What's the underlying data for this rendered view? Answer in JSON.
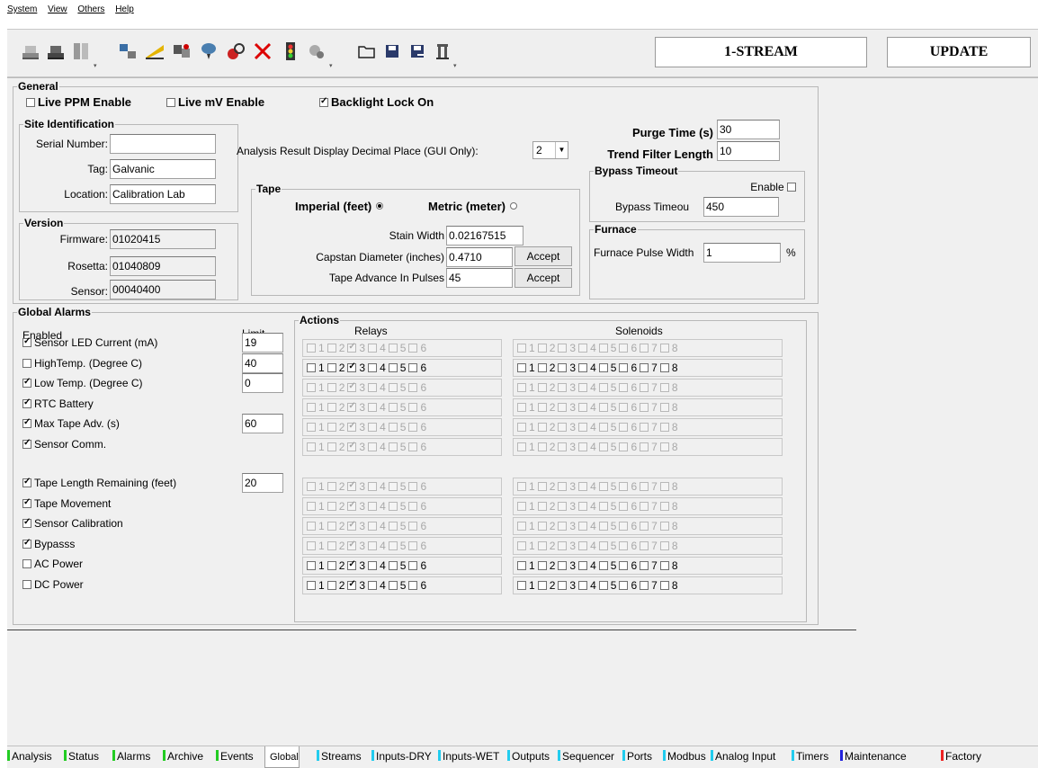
{
  "menu": [
    "System",
    "View",
    "Others",
    "Help"
  ],
  "toolbar": {
    "icons": [
      "dry-tank-icon",
      "wet-tank-icon",
      "stack-icon",
      "device-link-icon",
      "scan-icon",
      "transfer-icon",
      "balloon-icon",
      "bomb-reset-icon",
      "cancel-icon",
      "traffic-light-icon",
      "gears-icon",
      "open-folder-icon",
      "save-icon",
      "save-as-icon",
      "user-icon"
    ],
    "stream_label": "1-STREAM",
    "update_label": "UPDATE"
  },
  "general": {
    "title": "General",
    "live_ppm": {
      "label": "Live PPM Enable",
      "checked": false
    },
    "live_mv": {
      "label": "Live mV Enable",
      "checked": false
    },
    "backlight": {
      "label": "Backlight Lock On",
      "checked": true
    },
    "decimal_label": "Analysis Result Display Decimal Place (GUI Only):",
    "decimal_value": "2",
    "purge_label": "Purge Time (s)",
    "purge_value": "30",
    "trend_label": "Trend Filter Length",
    "trend_value": "10"
  },
  "site": {
    "title": "Site Identification",
    "serial_label": "Serial Number:",
    "serial_value": "",
    "tag_label": "Tag:",
    "tag_value": "Galvanic",
    "location_label": "Location:",
    "location_value": "Calibration Lab"
  },
  "version": {
    "title": "Version",
    "firmware_label": "Firmware:",
    "firmware_value": "01020415",
    "rosetta_label": "Rosetta:",
    "rosetta_value": "01040809",
    "sensor_label": "Sensor:",
    "sensor_value": "00040400"
  },
  "tape": {
    "title": "Tape",
    "imperial_label": "Imperial (feet)",
    "metric_label": "Metric (meter)",
    "stain_label": "Stain Width",
    "stain_value": "0.02167515",
    "capstan_label": "Capstan Diameter (inches)",
    "capstan_value": "0.4710",
    "advance_label": "Tape Advance In Pulses",
    "advance_value": "45",
    "accept_label": "Accept"
  },
  "bypass": {
    "title": "Bypass Timeout",
    "enable_label": "Enable",
    "timeout_label": "Bypass Timeou",
    "timeout_value": "450"
  },
  "furnace": {
    "title": "Furnace",
    "pulse_label": "Furnace Pulse Width",
    "pulse_value": "1",
    "unit": "%"
  },
  "alarms": {
    "title": "Global Alarms",
    "enabled_header": "Enabled",
    "limit_header": "Limit",
    "rows": [
      {
        "label": "Sensor LED Current (mA)",
        "checked": true,
        "limit": "19"
      },
      {
        "label": "HighTemp. (Degree C)",
        "checked": false,
        "limit": "40"
      },
      {
        "label": "Low Temp. (Degree C)",
        "checked": true,
        "limit": "0"
      },
      {
        "label": "RTC Battery",
        "checked": true,
        "limit": null
      },
      {
        "label": "Max Tape Adv. (s)",
        "checked": true,
        "limit": "60"
      },
      {
        "label": "Sensor Comm.",
        "checked": true,
        "limit": null
      },
      {
        "label": "Tape Length Remaining (feet)",
        "checked": true,
        "limit": "20"
      },
      {
        "label": "Tape Movement",
        "checked": true,
        "limit": null
      },
      {
        "label": "Sensor Calibration",
        "checked": true,
        "limit": null
      },
      {
        "label": "Bypasss",
        "checked": true,
        "limit": null
      },
      {
        "label": "AC Power",
        "checked": false,
        "limit": null
      },
      {
        "label": "DC Power",
        "checked": false,
        "limit": null
      }
    ]
  },
  "actions": {
    "title": "Actions",
    "relays_label": "Relays",
    "solenoids_label": "Solenoids",
    "relay_numbers": [
      "1",
      "2",
      "3",
      "4",
      "5",
      "6"
    ],
    "solenoid_numbers": [
      "1",
      "2",
      "3",
      "4",
      "5",
      "6",
      "7",
      "8"
    ],
    "header_enabled": false,
    "rows_enabled": [
      true,
      false,
      false,
      false,
      false,
      false,
      false,
      false,
      false,
      true,
      true
    ]
  },
  "tabs": [
    {
      "label": "Analysis",
      "color": "#22cc22"
    },
    {
      "label": "Status",
      "color": "#22cc22"
    },
    {
      "label": "Alarms",
      "color": "#22cc22"
    },
    {
      "label": "Archive",
      "color": "#22cc22"
    },
    {
      "label": "Events",
      "color": "#22cc22"
    },
    {
      "label": "Global",
      "color": null
    },
    {
      "label": "Streams",
      "color": "#22ccee"
    },
    {
      "label": "Inputs-DRY",
      "color": "#22ccee"
    },
    {
      "label": "Inputs-WET",
      "color": "#22ccee"
    },
    {
      "label": "Outputs",
      "color": "#22ccee"
    },
    {
      "label": "Sequencer",
      "color": "#22ccee"
    },
    {
      "label": "Ports",
      "color": "#22ccee"
    },
    {
      "label": "Modbus",
      "color": "#22ccee"
    },
    {
      "label": "Analog Input",
      "color": "#22ccee"
    },
    {
      "label": "Timers",
      "color": "#22ccee"
    },
    {
      "label": "Maintenance",
      "color": "#2222dd"
    },
    {
      "label": "Factory",
      "color": "#ee2222"
    }
  ]
}
